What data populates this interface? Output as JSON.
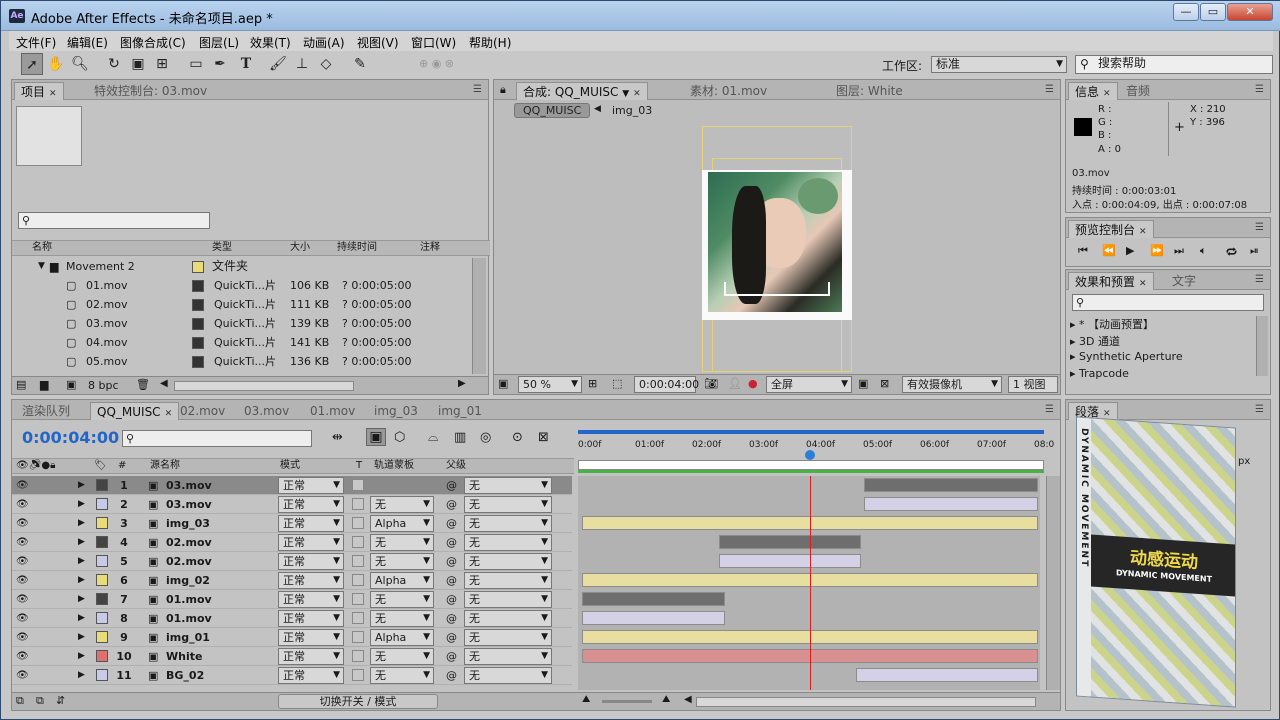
{
  "app": {
    "title": "Adobe After Effects - 未命名项目.aep *",
    "logo": "Ae",
    "window_buttons": [
      "—",
      "▭",
      "✕"
    ]
  },
  "menu": [
    "文件(F)",
    "编辑(E)",
    "图像合成(C)",
    "图层(L)",
    "效果(T)",
    "动画(A)",
    "视图(V)",
    "窗口(W)",
    "帮助(H)"
  ],
  "toolbar": {
    "workspace_label": "工作区:",
    "workspace_value": "标准",
    "search_placeholder": "搜索帮助",
    "tools": [
      "selection-tool-icon",
      "hand-tool-icon",
      "zoom-tool-icon",
      "rotate-tool-icon",
      "camera-tool-icon",
      "pan-behind-tool-icon",
      "rectangle-tool-icon",
      "pen-tool-icon",
      "text-tool-icon",
      "brush-tool-icon",
      "clone-stamp-tool-icon",
      "eraser-tool-icon",
      "puppet-pin-tool-icon"
    ]
  },
  "project_panel": {
    "tabs": [
      "项目",
      "特效控制台: 03.mov"
    ],
    "columns": [
      "名称",
      "类型",
      "大小",
      "持续时间",
      "注释"
    ],
    "folder": {
      "name": "Movement 2",
      "type": "文件夹"
    },
    "items": [
      {
        "name": "01.mov",
        "type": "QuickTi...片",
        "size": "106 KB",
        "duration": "? 0:00:05:00"
      },
      {
        "name": "02.mov",
        "type": "QuickTi...片",
        "size": "111 KB",
        "duration": "? 0:00:05:00"
      },
      {
        "name": "03.mov",
        "type": "QuickTi...片",
        "size": "139 KB",
        "duration": "? 0:00:05:00"
      },
      {
        "name": "04.mov",
        "type": "QuickTi...片",
        "size": "141 KB",
        "duration": "? 0:00:05:00"
      },
      {
        "name": "05.mov",
        "type": "QuickTi...片",
        "size": "136 KB",
        "duration": "? 0:00:05:00"
      }
    ],
    "bpc": "8 bpc"
  },
  "comp_panel": {
    "tabs": [
      "合成: QQ_MUISC",
      "素材: 01.mov",
      "图层: White"
    ],
    "breadcrumb": [
      "QQ_MUISC",
      "img_03"
    ],
    "zoom": "50 %",
    "timecode": "0:00:04:00",
    "resolution": "全屏",
    "camera": "有效摄像机",
    "views": "1 视图"
  },
  "info_panel": {
    "tabs": [
      "信息",
      "音频"
    ],
    "r": "R :",
    "g": "G :",
    "b": "B :",
    "a": "A : 0",
    "x": "X : 210",
    "y": "Y : 396",
    "file": "03.mov",
    "duration": "持续时间 : 0:00:03:01",
    "inout": "入点 : 0:00:04:09, 出点 : 0:00:07:08"
  },
  "preview_panel": {
    "title": "预览控制台"
  },
  "effects_panel": {
    "tabs": [
      "效果和预置",
      "文字"
    ],
    "items": [
      "* 【动画预置】",
      "3D 通道",
      "Synthetic Aperture",
      "Trapcode"
    ]
  },
  "paragraph_panel": {
    "title": "段落",
    "px": "px"
  },
  "book_cover": {
    "title_cn": "动感运动",
    "title_en": "DYNAMIC MOVEMENT",
    "spine": "DYNAMIC MOVEMENT"
  },
  "timeline": {
    "tabs": [
      "渲染队列",
      "QQ_MUISC",
      "02.mov",
      "03.mov",
      "01.mov",
      "img_03",
      "img_01"
    ],
    "timecode": "0:00:04:00",
    "columns": {
      "num": "#",
      "name": "源名称",
      "mode": "模式",
      "t": "T",
      "track": "轨道蒙板",
      "parent": "父级"
    },
    "ruler": [
      "0:00f",
      "01:00f",
      "02:00f",
      "03:00f",
      "04:00f",
      "05:00f",
      "06:00f",
      "07:00f",
      "08:0"
    ],
    "toggle_label": "切换开关 / 模式",
    "colors": {
      "yellow": "#e8dea0",
      "gray": "#6e6e6e",
      "lavender": "#d4d0e6",
      "red": "#d99090",
      "playhead": "#e01b1b"
    },
    "layers": [
      {
        "num": "1",
        "name": "03.mov",
        "mode": "正常",
        "track": "",
        "parent": "无",
        "label": "#444444",
        "start": 4.95,
        "end": 8.0,
        "color": "gray",
        "selected": true
      },
      {
        "num": "2",
        "name": "03.mov",
        "mode": "正常",
        "track": "无",
        "parent": "无",
        "label": "#c9c9e8",
        "start": 4.95,
        "end": 8.0,
        "color": "lavender"
      },
      {
        "num": "3",
        "name": "img_03",
        "mode": "正常",
        "track": "Alpha",
        "parent": "无",
        "label": "#e8dc7a",
        "start": 0.0,
        "end": 8.0,
        "color": "yellow"
      },
      {
        "num": "4",
        "name": "02.mov",
        "mode": "正常",
        "track": "无",
        "parent": "无",
        "label": "#444444",
        "start": 2.4,
        "end": 4.9,
        "color": "gray"
      },
      {
        "num": "5",
        "name": "02.mov",
        "mode": "正常",
        "track": "无",
        "parent": "无",
        "label": "#c9c9e8",
        "start": 2.4,
        "end": 4.9,
        "color": "lavender"
      },
      {
        "num": "6",
        "name": "img_02",
        "mode": "正常",
        "track": "Alpha",
        "parent": "无",
        "label": "#e8dc7a",
        "start": 0.0,
        "end": 8.0,
        "color": "yellow"
      },
      {
        "num": "7",
        "name": "01.mov",
        "mode": "正常",
        "track": "无",
        "parent": "无",
        "label": "#444444",
        "start": 0.0,
        "end": 2.5,
        "color": "gray"
      },
      {
        "num": "8",
        "name": "01.mov",
        "mode": "正常",
        "track": "无",
        "parent": "无",
        "label": "#c9c9e8",
        "start": 0.0,
        "end": 2.5,
        "color": "lavender"
      },
      {
        "num": "9",
        "name": "img_01",
        "mode": "正常",
        "track": "Alpha",
        "parent": "无",
        "label": "#e8dc7a",
        "start": 0.0,
        "end": 8.0,
        "color": "yellow"
      },
      {
        "num": "10",
        "name": "White",
        "mode": "正常",
        "track": "无",
        "parent": "无",
        "label": "#e07070",
        "start": 0.0,
        "end": 8.0,
        "color": "red"
      },
      {
        "num": "11",
        "name": "BG_02",
        "mode": "正常",
        "track": "无",
        "parent": "无",
        "label": "#c9c9e8",
        "start": 4.8,
        "end": 8.0,
        "color": "lavender"
      }
    ],
    "playhead_seconds": 4.0,
    "duration_seconds": 8.0
  }
}
